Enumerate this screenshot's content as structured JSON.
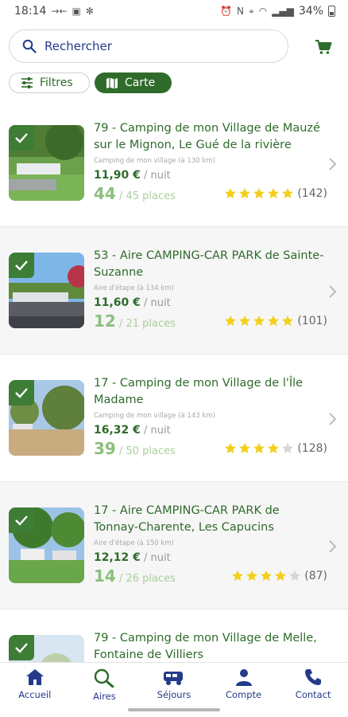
{
  "status": {
    "time": "18:14",
    "battery": "34%"
  },
  "search": {
    "label": "Rechercher"
  },
  "chips": {
    "filters": "Filtres",
    "map": "Carte"
  },
  "colors": {
    "primary": "#2f6b2b",
    "navy": "#243a8a",
    "star": "#f2cf1b",
    "star_empty": "#d6d6d6"
  },
  "listings": [
    {
      "title": "79 - Camping de mon Village de Mauzé sur le Mignon, Le Gué de la rivière",
      "type": "Camping de mon village (à 130 km)",
      "price": "11,90 €",
      "per": " / nuit",
      "available": "44",
      "total": " / 45 places",
      "stars": 5,
      "reviews": "(142)"
    },
    {
      "title": "53 - Aire CAMPING-CAR PARK de Sainte-Suzanne",
      "type": "Aire d'étape (à 134 km)",
      "price": "11,60 €",
      "per": " / nuit",
      "available": "12",
      "total": " / 21 places",
      "stars": 5,
      "reviews": "(101)"
    },
    {
      "title": "17 - Camping de mon Village de l'Île Madame",
      "type": "Camping de mon village (à 143 km)",
      "price": "16,32 €",
      "per": " / nuit",
      "available": "39",
      "total": " / 50 places",
      "stars": 4,
      "reviews": "(128)"
    },
    {
      "title": "17 - Aire CAMPING-CAR PARK de Tonnay-Charente, Les Capucins",
      "type": "Aire d'étape (à 150 km)",
      "price": "12,12 €",
      "per": " / nuit",
      "available": "14",
      "total": " / 26 places",
      "stars": 4,
      "reviews": "(87)"
    },
    {
      "title": "79 - Camping de mon Village de Melle, Fontaine de Villiers",
      "type": "",
      "price": "",
      "per": "",
      "available": "",
      "total": "",
      "stars": 0,
      "reviews": ""
    }
  ],
  "nav": [
    {
      "label": "Accueil",
      "icon": "home-icon"
    },
    {
      "label": "Aires",
      "icon": "search-icon"
    },
    {
      "label": "Séjours",
      "icon": "camper-van-icon"
    },
    {
      "label": "Compte",
      "icon": "person-icon"
    },
    {
      "label": "Contact",
      "icon": "phone-icon"
    }
  ]
}
